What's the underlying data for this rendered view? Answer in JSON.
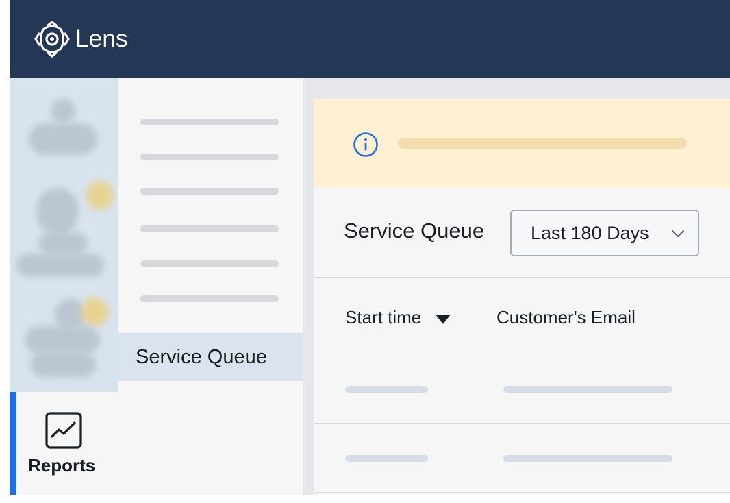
{
  "app": {
    "name": "Lens",
    "brand_color": "#253756",
    "accent_color": "#1f6fe5",
    "logo_icon": "lens-logo-icon"
  },
  "rail": {
    "active_item": {
      "label": "Reports",
      "icon": "reports-chart-icon"
    }
  },
  "menu": {
    "active_item_label": "Service Queue"
  },
  "banner": {
    "icon": "info-icon",
    "background_color": "#fff0d4"
  },
  "panel": {
    "title": "Service Queue",
    "date_filter": {
      "selected": "Last 180 Days",
      "icon": "chevron-down-icon"
    }
  },
  "table": {
    "columns": [
      {
        "label": "Start time",
        "sorted": "descending",
        "sort_icon": "sort-desc-icon"
      },
      {
        "label": "Customer's Email"
      }
    ]
  }
}
